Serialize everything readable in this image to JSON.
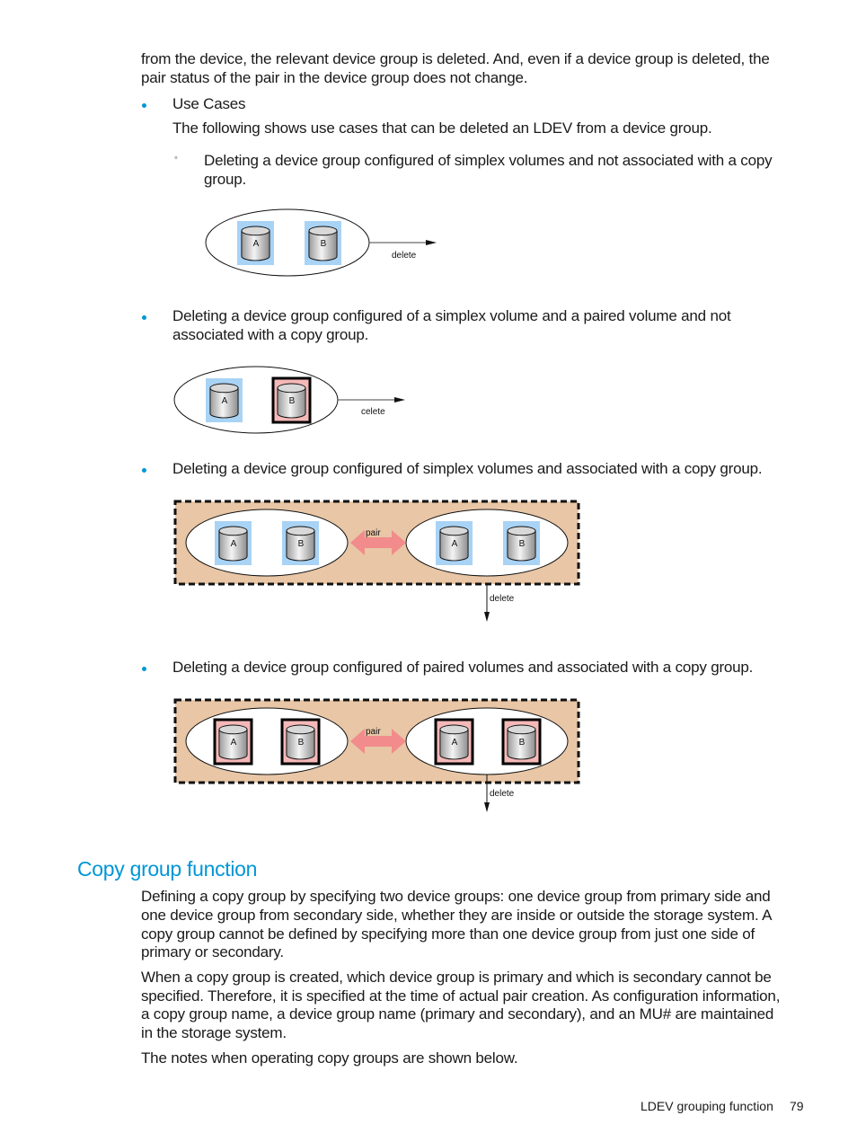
{
  "intro": {
    "line1": "from the device, the relevant device group is deleted. And, even if a device group is deleted, the",
    "line2": "pair status of the pair in the device group does not change."
  },
  "use_cases": {
    "label": "Use Cases",
    "description": "The following shows use cases that can be deleted an LDEV from a device group.",
    "items": [
      {
        "line1": "Deleting a device group configured of simplex volumes and not associated with a copy",
        "line2": "group."
      },
      {
        "line1": "Deleting a device group configured of a simplex volume and a paired volume and not",
        "line2": "associated with a copy group."
      },
      {
        "line1": "Deleting a device group configured of simplex volumes and associated with a copy group."
      },
      {
        "line1": "Deleting a device group configured of paired volumes and associated with a copy group."
      }
    ]
  },
  "diagrams": {
    "volume_a": "A",
    "volume_b": "B",
    "delete_label": "delete",
    "delete_label_typo": "celete",
    "pair_label": "pair",
    "colors": {
      "simplex_frame": "#a9d3f5",
      "paired_frame": "#000000",
      "paired_fill": "#f5b8b8",
      "copy_group_bg": "#e8c6a6",
      "pair_arrow": "#f28b8b"
    }
  },
  "copy_group": {
    "heading": "Copy group function",
    "para1": [
      "Defining a copy group by specifying two device groups: one device group from primary side and",
      "one device group from secondary side, whether they are inside or outside the storage system. A",
      "copy group cannot be defined by specifying more than one device group from just one side of",
      "primary or secondary."
    ],
    "para2": [
      "When a copy group is created, which device group is primary and which is secondary cannot be",
      "specified. Therefore, it is specified at the time of actual pair creation. As configuration information,",
      "a copy group name, a device group name (primary and secondary), and an MU# are maintained",
      "in the storage system."
    ],
    "para3": "The notes when operating copy groups are shown below."
  },
  "footer": {
    "section": "LDEV grouping function",
    "page": "79"
  }
}
